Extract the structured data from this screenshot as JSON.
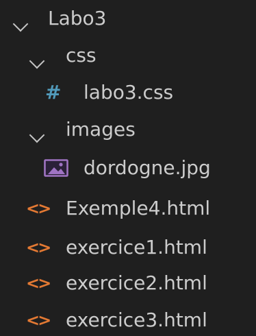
{
  "explorer": {
    "root": {
      "label": "Labo3",
      "icon": "chevron-down-icon"
    },
    "folders": [
      {
        "label": "css",
        "icon": "chevron-down-icon",
        "files": [
          {
            "label": "labo3.css",
            "icon": "css-file-icon",
            "icon_glyph": "#",
            "icon_color": "#519aba"
          }
        ]
      },
      {
        "label": "images",
        "icon": "chevron-down-icon",
        "files": [
          {
            "label": "dordogne.jpg",
            "icon": "image-file-icon",
            "icon_color": "#a074c4"
          }
        ]
      }
    ],
    "files": [
      {
        "label": "Exemple4.html",
        "icon": "html-file-icon",
        "icon_glyph": "<>",
        "icon_color": "#e37933"
      },
      {
        "label": "exercice1.html",
        "icon": "html-file-icon",
        "icon_glyph": "<>",
        "icon_color": "#e37933"
      },
      {
        "label": "exercice2.html",
        "icon": "html-file-icon",
        "icon_glyph": "<>",
        "icon_color": "#e37933"
      },
      {
        "label": "exercice3.html",
        "icon": "html-file-icon",
        "icon_glyph": "<>",
        "icon_color": "#e37933"
      }
    ]
  },
  "colors": {
    "background": "#1f1f1f",
    "text": "#cccccc",
    "chevron": "#c5c5c5"
  }
}
